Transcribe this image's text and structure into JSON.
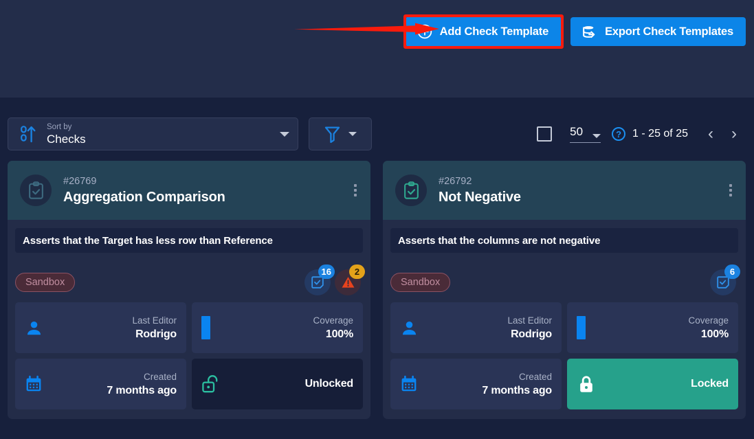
{
  "topbar": {
    "add_button": {
      "label": "Add Check Template",
      "icon": "plus-circle-icon",
      "highlighted": true
    },
    "export_button": {
      "label": "Export Check Templates",
      "icon": "export-icon"
    },
    "accent_blue": "#0c85e8",
    "highlight_color": "#f91b0c"
  },
  "annotation": {
    "type": "arrow",
    "color": "#f91b0c",
    "points_to": "Add Check Template"
  },
  "toolbar": {
    "sort": {
      "caption": "Sort by",
      "value": "Checks",
      "icon": "sort-numeric-asc-icon",
      "caret": "chevron-down-icon"
    },
    "filter": {
      "icon": "filter-icon",
      "caret": "chevron-down-icon"
    },
    "pagination": {
      "select_all_checkbox": "unchecked",
      "page_size": "50",
      "help_icon": "question-circle-icon",
      "range": "1 - 25 of 25",
      "prev": "‹",
      "next": "›"
    }
  },
  "cards": [
    {
      "id": "#26769",
      "title": "Aggregation Comparison",
      "icon": "clipboard-check-icon",
      "icon_color": "#3d6a80",
      "menu_icon": "kebab-menu-icon",
      "description": "Asserts that the Target has less row than Reference",
      "tag": "Sandbox",
      "stats": [
        {
          "icon": "check-square-icon",
          "count": "16",
          "kind": "blue"
        },
        {
          "icon": "warning-triangle-icon",
          "count": "2",
          "kind": "amber"
        }
      ],
      "tiles": [
        {
          "icon": "user-icon",
          "label": "Last Editor",
          "value": "Rodrigo"
        },
        {
          "icon": "coverage-bar-icon",
          "label": "Coverage",
          "value": "100%"
        },
        {
          "icon": "calendar-icon",
          "label": "Created",
          "value": "7 months ago"
        }
      ],
      "lock": {
        "icon": "unlock-icon",
        "label": "Unlocked",
        "state": "unlocked"
      }
    },
    {
      "id": "#26792",
      "title": "Not Negative",
      "icon": "clipboard-check-icon",
      "icon_color": "#2fa88f",
      "menu_icon": "kebab-menu-icon",
      "description": "Asserts that the columns are not negative",
      "tag": "Sandbox",
      "stats": [
        {
          "icon": "check-square-icon",
          "count": "6",
          "kind": "blue"
        }
      ],
      "tiles": [
        {
          "icon": "user-icon",
          "label": "Last Editor",
          "value": "Rodrigo"
        },
        {
          "icon": "coverage-bar-icon",
          "label": "Coverage",
          "value": "100%"
        },
        {
          "icon": "calendar-icon",
          "label": "Created",
          "value": "7 months ago"
        }
      ],
      "lock": {
        "icon": "lock-icon",
        "label": "Locked",
        "state": "locked"
      }
    }
  ]
}
